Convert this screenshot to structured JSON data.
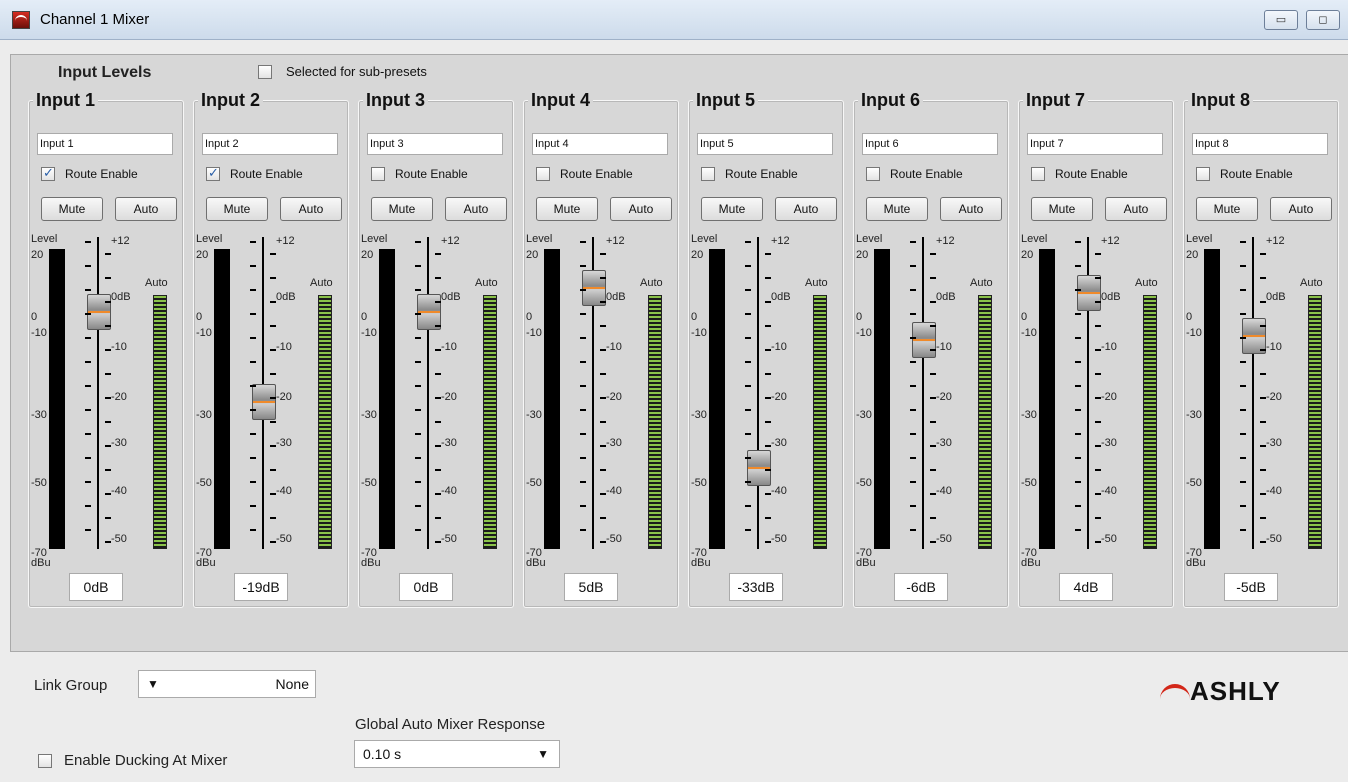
{
  "window": {
    "title": "Channel 1  Mixer",
    "minimize_glyph": "▭",
    "restore_glyph": "◻"
  },
  "panel": {
    "title": "Input Levels",
    "subpresets_label": "Selected for sub-presets",
    "subpresets_checked": false
  },
  "strip_labels": {
    "route_enable": "Route Enable",
    "mute": "Mute",
    "auto": "Auto",
    "level": "Level",
    "dbu": "dBu",
    "meter_scale": [
      "20",
      "0",
      "-10",
      "-30",
      "-50",
      "-70"
    ],
    "fader_scale": [
      "+12",
      "0dB",
      "-10",
      "-20",
      "-30",
      "-40",
      "-50"
    ],
    "auto_meter": "Auto"
  },
  "inputs": [
    {
      "title": "Input 1",
      "name": "Input 1",
      "route_enabled": true,
      "level": "0dB"
    },
    {
      "title": "Input 2",
      "name": "Input 2",
      "route_enabled": true,
      "level": "-19dB"
    },
    {
      "title": "Input 3",
      "name": "Input 3",
      "route_enabled": false,
      "level": "0dB"
    },
    {
      "title": "Input 4",
      "name": "Input 4",
      "route_enabled": false,
      "level": "5dB"
    },
    {
      "title": "Input 5",
      "name": "Input 5",
      "route_enabled": false,
      "level": "-33dB"
    },
    {
      "title": "Input 6",
      "name": "Input 6",
      "route_enabled": false,
      "level": "-6dB"
    },
    {
      "title": "Input 7",
      "name": "Input 7",
      "route_enabled": false,
      "level": "4dB"
    },
    {
      "title": "Input 8",
      "name": "Input 8",
      "route_enabled": false,
      "level": "-5dB"
    }
  ],
  "footer": {
    "link_group_label": "Link Group",
    "link_group_value": "None",
    "global_response_label": "Global Auto Mixer Response",
    "global_response_value": "0.10 s",
    "ducking_label": "Enable Ducking At Mixer",
    "ducking_checked": false,
    "brand": "ASHLY"
  }
}
